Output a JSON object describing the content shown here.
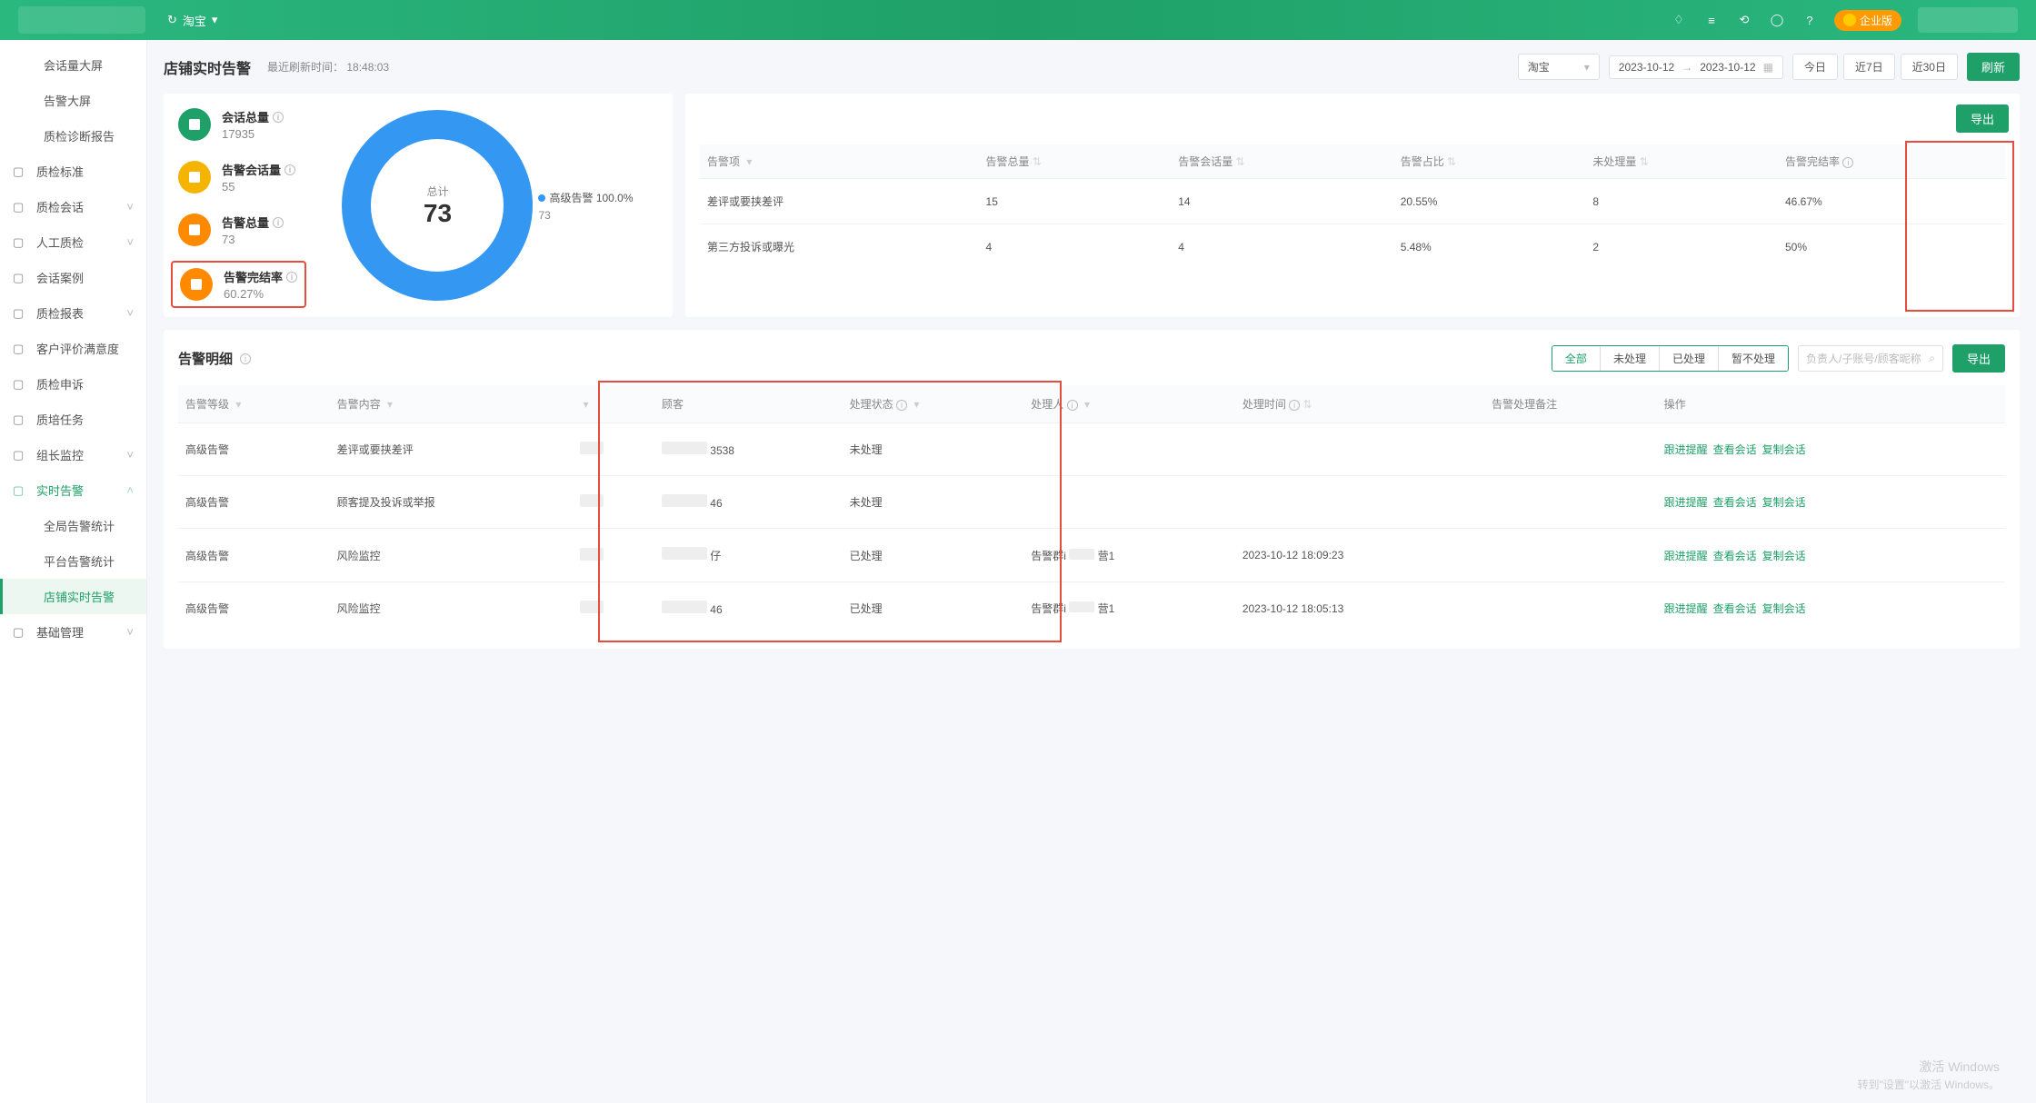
{
  "header": {
    "platform": "淘宝",
    "badge": "企业版"
  },
  "sidebar": {
    "items": [
      {
        "label": "会话量大屏",
        "indent": true
      },
      {
        "label": "告警大屏",
        "indent": true
      },
      {
        "label": "质检诊断报告",
        "indent": true
      },
      {
        "label": "质检标准",
        "icon": "doc"
      },
      {
        "label": "质检会话",
        "icon": "chat",
        "arrow": true
      },
      {
        "label": "人工质检",
        "icon": "person",
        "arrow": true
      },
      {
        "label": "会话案例",
        "icon": "layers"
      },
      {
        "label": "质检报表",
        "icon": "bar",
        "arrow": true
      },
      {
        "label": "客户评价满意度",
        "icon": "note"
      },
      {
        "label": "质检申诉",
        "icon": "expand"
      },
      {
        "label": "质培任务",
        "icon": "expand"
      },
      {
        "label": "组长监控",
        "icon": "clock",
        "arrow": true
      },
      {
        "label": "实时告警",
        "icon": "bell",
        "arrow": "up",
        "blue": true
      },
      {
        "label": "全局告警统计",
        "sub": true
      },
      {
        "label": "平台告警统计",
        "sub": true
      },
      {
        "label": "店铺实时告警",
        "sub": true,
        "active": true
      },
      {
        "label": "基础管理",
        "icon": "user",
        "arrow": true
      }
    ]
  },
  "titlebar": {
    "title": "店铺实时告警",
    "refresh_label": "最近刷新时间：",
    "refresh_time": "18:48:03",
    "platform_filter": "淘宝",
    "date_start": "2023-10-12",
    "date_sep": "→",
    "date_end": "2023-10-12",
    "quick": [
      "今日",
      "近7日",
      "近30日"
    ],
    "refresh_btn": "刷新"
  },
  "stats": [
    {
      "label": "会话总量",
      "value": "17935",
      "color": "#1fa068"
    },
    {
      "label": "告警会话量",
      "value": "55",
      "color": "#f4b400"
    },
    {
      "label": "告警总量",
      "value": "73",
      "color": "#ff8a00"
    },
    {
      "label": "告警完结率",
      "value": "60.27%",
      "color": "#ff8a00",
      "hl": true
    }
  ],
  "donut": {
    "center_label": "总计",
    "center_value": "73",
    "legend_label": "高级告警 100.0%",
    "legend_sub": "73"
  },
  "summary_table": {
    "export": "导出",
    "headers": [
      "告警项",
      "告警总量",
      "告警会话量",
      "告警占比",
      "未处理量",
      "告警完结率"
    ],
    "rows": [
      {
        "item": "差评或要挟差评",
        "total": "15",
        "sess": "14",
        "pct": "20.55%",
        "pending": "8",
        "rate": "46.67%"
      },
      {
        "item": "第三方投诉或曝光",
        "total": "4",
        "sess": "4",
        "pct": "5.48%",
        "pending": "2",
        "rate": "50%"
      }
    ]
  },
  "detail": {
    "title": "告警明细",
    "tabs": [
      "全部",
      "未处理",
      "已处理",
      "暂不处理"
    ],
    "search_placeholder": "负责人/子账号/顾客昵称",
    "export": "导出",
    "headers": [
      "告警等级",
      "告警内容",
      "",
      "顾客",
      "处理状态",
      "处理人",
      "处理时间",
      "告警处理备注",
      "操作"
    ],
    "actions": [
      "跟进提醒",
      "查看会话",
      "复制会话"
    ],
    "rows": [
      {
        "level": "高级告警",
        "content": "差评或要挟差评",
        "cust_suffix": "3538",
        "status": "未处理",
        "handler": "",
        "time": ""
      },
      {
        "level": "高级告警",
        "content": "顾客提及投诉或举报",
        "cust_suffix": "46",
        "status": "未处理",
        "handler": "",
        "time": ""
      },
      {
        "level": "高级告警",
        "content": "风险监控",
        "cust_suffix": "仔",
        "status": "已处理",
        "handler_pre": "告警群i",
        "handler_suf": "营1",
        "time": "2023-10-12 18:09:23"
      },
      {
        "level": "高级告警",
        "content": "风险监控",
        "cust_suffix": "46",
        "status": "已处理",
        "handler_pre": "告警群i",
        "handler_suf": "营1",
        "time": "2023-10-12 18:05:13"
      }
    ]
  },
  "watermark": {
    "line1": "激活 Windows",
    "line2": "转到\"设置\"以激活 Windows。"
  }
}
